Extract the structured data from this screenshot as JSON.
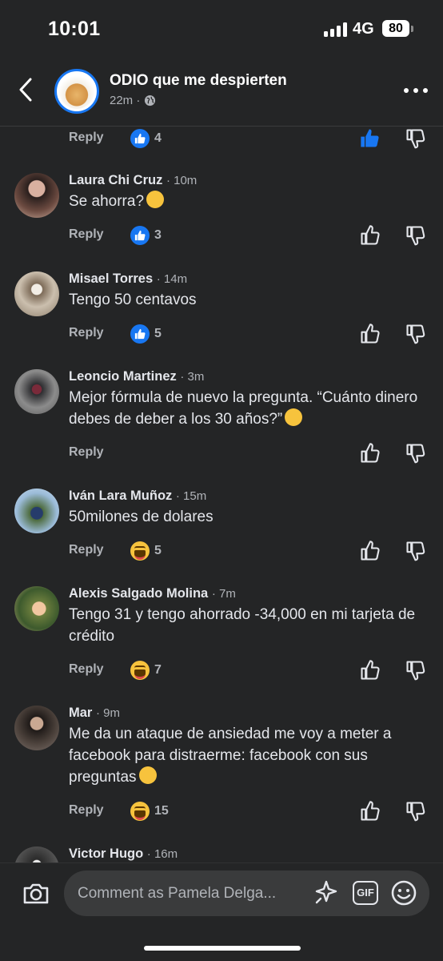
{
  "status_bar": {
    "time": "10:01",
    "network": "4G",
    "battery": "80"
  },
  "header": {
    "group_name": "ODIO que me despierten",
    "meta_time": "22m ·"
  },
  "top_row": {
    "reply": "Reply",
    "reaction_count": "4"
  },
  "comments": [
    {
      "author": "Laura Chi Cruz",
      "time": "· 10m",
      "text": "Se ahorra?",
      "reply": "Reply",
      "reaction": "like",
      "count": "3"
    },
    {
      "author": "Misael Torres",
      "time": "· 14m",
      "text": "Tengo 50 centavos",
      "reply": "Reply",
      "reaction": "like",
      "count": "5"
    },
    {
      "author": "Leoncio Martinez",
      "time": "· 3m",
      "text": "Mejor fórmula de nuevo la pregunta. “Cuánto dinero debes de deber a los 30 años?”",
      "reply": "Reply"
    },
    {
      "author": "Iván Lara Muñoz",
      "time": "· 15m",
      "text": "50milones de dolares",
      "reply": "Reply",
      "reaction": "haha",
      "count": "5"
    },
    {
      "author": "Alexis Salgado Molina",
      "time": "· 7m",
      "text": "Tengo 31 y tengo ahorrado -34,000 en mi tarjeta de crédito",
      "reply": "Reply",
      "reaction": "haha",
      "count": "7"
    },
    {
      "author": "Mar",
      "time": "· 9m",
      "text": "Me da un ataque de ansiedad me voy a meter a facebook para distraerme: facebook con sus preguntas",
      "reply": "Reply",
      "reaction": "haha",
      "count": "15"
    },
    {
      "author": "Victor Hugo",
      "time": "· 16m"
    }
  ],
  "composer": {
    "placeholder": "Comment as Pamela Delga...",
    "gif_label": "GIF"
  },
  "colors": {
    "background": "#242526",
    "accent": "#1877f2",
    "muted": "#b0b3b8",
    "haha": "#f7c33d"
  }
}
